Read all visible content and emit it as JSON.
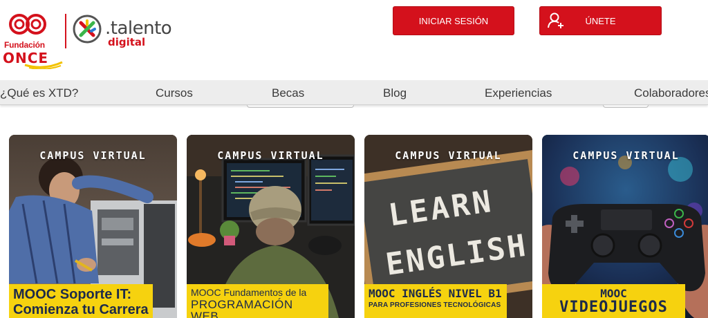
{
  "header": {
    "once_logo": {
      "line1": "Fundación",
      "line2": "ONCE"
    },
    "xtd_logo": {
      "word1": ".talento",
      "word2": "digital"
    },
    "login_button": "INICIAR SESIÓN",
    "join_button": "ÚNETE",
    "icons": {
      "join": "user-plus-icon"
    },
    "colors": {
      "brand_red": "#d4111c",
      "label_yellow": "#f6d20f",
      "nav_bg": "#ededed"
    }
  },
  "nav": {
    "items": [
      "¿Qué es XTD?",
      "Cursos",
      "Becas",
      "Blog",
      "Experiencias",
      "Colaboradores"
    ]
  },
  "cards": [
    {
      "campus": "CAMPUS VIRTUAL",
      "line1": "MOOC Soporte IT:",
      "line2": "Comienza tu Carrera"
    },
    {
      "campus": "CAMPUS VIRTUAL",
      "line1": "MOOC Fundamentos de la",
      "line2": "PROGRAMACIÓN WEB"
    },
    {
      "campus": "CAMPUS VIRTUAL",
      "line1": "MOOC INGLÉS NIVEL B1",
      "line2": "PARA PROFESIONES TECNOLÓGICAS",
      "board_line1": "LEARN",
      "board_line2": "ENGLISH"
    },
    {
      "campus": "CAMPUS VIRTUAL",
      "line1": "MOOC",
      "line2": "VIDEOJUEGOS"
    }
  ]
}
